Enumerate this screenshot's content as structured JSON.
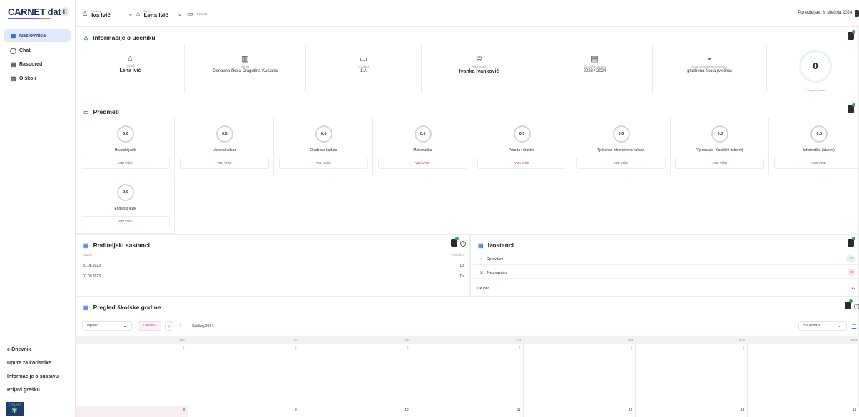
{
  "sidebar": {
    "logo": "CARNET data",
    "nav": [
      {
        "label": "Naslovnica",
        "icon": "grid-icon"
      },
      {
        "label": "Chat",
        "icon": "chat-icon"
      },
      {
        "label": "Raspored",
        "icon": "calendar-icon"
      },
      {
        "label": "O školi",
        "icon": "building-icon"
      }
    ],
    "bottom_links": [
      "e-Dnevnik",
      "Upute za korisnike",
      "Informacije o sustavu",
      "Prijavi grešku"
    ],
    "footer_logo": "CTRL+FT"
  },
  "topbar": {
    "parent_label": "Roditelj",
    "parent_value": "Iva Ivić",
    "student_label": "Dijete",
    "student_value": "Lena Ivić",
    "class_placeholder": "Razred",
    "date": "Ponedjeljak, 8. siječnja 2024."
  },
  "info": {
    "title": "Informacije o učeniku",
    "cells": [
      {
        "label": "Učenik",
        "value": "Lena Ivić",
        "bold": true
      },
      {
        "label": "Škola",
        "value": "Osnovna škola Dragutina Kušlana",
        "bold": false
      },
      {
        "label": "Razred",
        "value": "1.A",
        "bold": false
      },
      {
        "label": "Razrednik",
        "value": "Ivanka Ivanković",
        "bold": true
      },
      {
        "label": "Školska godina",
        "value": "2023 / 2024",
        "bold": false
      },
      {
        "label": "Izvannastavne aktivnosti",
        "value": "glazbena škola (violina)",
        "bold": false
      }
    ],
    "average_value": "0",
    "average_label": "Ukupan prosjek"
  },
  "subjects": {
    "title": "Predmeti",
    "view_more": "VIDI VIŠE",
    "items": [
      {
        "name": "Hrvatski jezik",
        "grade": "0,0"
      },
      {
        "name": "Likovna kultura",
        "grade": "0,0"
      },
      {
        "name": "Glazbena kultura",
        "grade": "0,0"
      },
      {
        "name": "Matematika",
        "grade": "0,0"
      },
      {
        "name": "Priroda i društvo",
        "grade": "0,0"
      },
      {
        "name": "Tjelesna i zdravstvena kultura",
        "grade": "0,0"
      },
      {
        "name": "Vjeronauk - Katolički (izborni)",
        "grade": "0,0"
      },
      {
        "name": "Informatika (izborni)",
        "grade": "0,0"
      },
      {
        "name": "Engleski jezik",
        "grade": "0,0"
      }
    ]
  },
  "meetings": {
    "title": "Roditeljski sastanci",
    "col_date": "Datum",
    "col_present": "Prisustvo",
    "rows": [
      {
        "date": "31.08.2023.",
        "present": "Da"
      },
      {
        "date": "07.09.2023.",
        "present": "Da"
      }
    ]
  },
  "absences": {
    "title": "Izostanci",
    "rows": [
      {
        "label": "Opravdani",
        "count": "42"
      },
      {
        "label": "Neopravdani",
        "count": "0"
      }
    ],
    "total_label": "Ukupno",
    "total_value": "42"
  },
  "calendar": {
    "title": "Pregled školske godine",
    "view_select": "Mjesec",
    "today_btn": "DANAS",
    "month_label": "Siječanj 2024.",
    "filter_select": "Svi podaci",
    "days": [
      "Pon",
      "Uto",
      "Sri",
      "Čet",
      "Pet",
      "Sub",
      "Ned"
    ],
    "week1": [
      "1",
      "2",
      "3",
      "4",
      "5",
      "6",
      ""
    ],
    "week2": [
      "8",
      "9",
      "10",
      "11",
      "12",
      "13",
      "14"
    ]
  }
}
